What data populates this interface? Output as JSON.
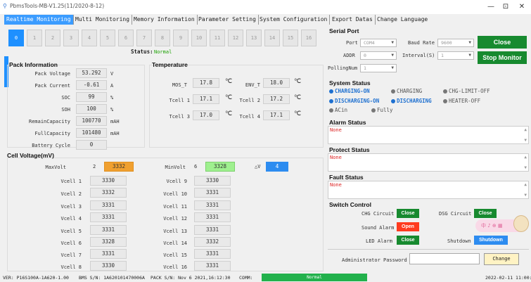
{
  "window": {
    "title": "PbmsTools-MB-V1.25(11/2020-8-12)",
    "minimize": "—",
    "maximize": "⊡",
    "close": "✕"
  },
  "tabs": [
    "Realtime Monitoring",
    "Multi Monitoring",
    "Memory Information",
    "Parameter Setting",
    "System Configuration",
    "Export Datas",
    "Change Language"
  ],
  "pack_buttons": [
    "0",
    "1",
    "2",
    "3",
    "4",
    "5",
    "6",
    "7",
    "8",
    "9",
    "10",
    "11",
    "12",
    "13",
    "14",
    "15",
    "16"
  ],
  "status": {
    "label": "Status:",
    "value": "Normal"
  },
  "pack_info": {
    "title": "Pack Information",
    "rows": [
      {
        "label": "Pack Voltage",
        "value": "53.292",
        "unit": "V"
      },
      {
        "label": "Pack Current",
        "value": "-0.61",
        "unit": "A"
      },
      {
        "label": "SOC",
        "value": "99",
        "unit": "%"
      },
      {
        "label": "SOH",
        "value": "100",
        "unit": "%"
      },
      {
        "label": "RemainCapacity",
        "value": "100770",
        "unit": "mAH"
      },
      {
        "label": "FullCapacity",
        "value": "101480",
        "unit": "mAH"
      },
      {
        "label": "Battery Cycle",
        "value": "0",
        "unit": ""
      }
    ]
  },
  "temperature": {
    "title": "Temperature",
    "mos_t": {
      "label": "MOS_T",
      "value": "17.8"
    },
    "env_t": {
      "label": "ENV_T",
      "value": "18.0"
    },
    "tcell1": {
      "label": "Tcell 1",
      "value": "17.1"
    },
    "tcell2": {
      "label": "Tcell 2",
      "value": "17.2"
    },
    "tcell3": {
      "label": "Tcell 3",
      "value": "17.0"
    },
    "tcell4": {
      "label": "Tcell 4",
      "value": "17.1"
    },
    "unit": "℃"
  },
  "cell_voltage": {
    "title": "Cell Voltage(mV)",
    "max_label": "MaxVolt",
    "max_index": "2",
    "max_value": "3332",
    "min_label": "MinVolt",
    "min_index": "6",
    "min_value": "3328",
    "delta_label": "△V",
    "delta_value": "4",
    "left": [
      {
        "label": "Vcell 1",
        "value": "3330"
      },
      {
        "label": "Vcell 2",
        "value": "3332"
      },
      {
        "label": "Vcell 3",
        "value": "3331"
      },
      {
        "label": "Vcell 4",
        "value": "3331"
      },
      {
        "label": "Vcell 5",
        "value": "3331"
      },
      {
        "label": "Vcell 6",
        "value": "3328"
      },
      {
        "label": "Vcell 7",
        "value": "3331"
      },
      {
        "label": "Vcell 8",
        "value": "3330"
      }
    ],
    "right": [
      {
        "label": "Vcell 9",
        "value": "3330"
      },
      {
        "label": "Vcell 10",
        "value": "3331"
      },
      {
        "label": "Vcell 11",
        "value": "3331"
      },
      {
        "label": "Vcell 12",
        "value": "3331"
      },
      {
        "label": "Vcell 13",
        "value": "3331"
      },
      {
        "label": "Vcell 14",
        "value": "3332"
      },
      {
        "label": "Vcell 15",
        "value": "3331"
      },
      {
        "label": "Vcell 16",
        "value": "3331"
      }
    ]
  },
  "serial_port": {
    "title": "Serial Port",
    "port_label": "Port",
    "port_value": "COM4",
    "baud_label": "Baud Rate",
    "baud_value": "9600",
    "addr_label": "ADDR",
    "addr_value": "0",
    "interval_label": "Interval(S)",
    "interval_value": "1",
    "polling_label": "PollingNum",
    "polling_value": "1",
    "close_button": "Close",
    "stop_button": "Stop Monitor"
  },
  "system_status": {
    "title": "System Status",
    "items": [
      {
        "label": "CHARGING-ON",
        "on": true
      },
      {
        "label": "CHARGING",
        "on": false
      },
      {
        "label": "CHG-LIMIT-OFF",
        "on": false
      },
      {
        "label": "DISCHARGING-ON",
        "on": true
      },
      {
        "label": "DISCHARGING",
        "on": true
      },
      {
        "label": "HEATER-OFF",
        "on": false
      },
      {
        "label": "ACin",
        "on": false
      },
      {
        "label": "Fully",
        "on": false
      }
    ]
  },
  "alarm_status": {
    "title": "Alarm Status",
    "value": "None"
  },
  "protect_status": {
    "title": "Protect Status",
    "value": "None"
  },
  "fault_status": {
    "title": "Fault Status",
    "value": "None"
  },
  "switch_control": {
    "title": "Switch Control",
    "chg_label": "CHG Circuit",
    "chg_button": "Close",
    "dsg_label": "DSG Circuit",
    "dsg_button": "Close",
    "sound_label": "Sound Alarm",
    "sound_button": "Open",
    "led_label": "LED Alarm",
    "led_button": "Close",
    "shutdown_label": "Shutdown",
    "shutdown_button": "Shutdown",
    "sticker_text": "中 ♪ ⊕ ▦"
  },
  "admin": {
    "label": "Administrator Password",
    "button": "Change"
  },
  "statusbar": {
    "ver": "VER: P16S100A-1A620-1.00",
    "bms_sn": "BMS S/N: 1A620101470006A",
    "pack_sn": "PACK S/N: Nov  6 2021,16:12:30",
    "comm_label": "COMM:",
    "comm_value": "Normal",
    "datetime": "2022-02-11 11:00:4"
  },
  "colors": {
    "accent": "#1e90ff",
    "green": "#178a2f",
    "red": "#ff3b1f"
  }
}
